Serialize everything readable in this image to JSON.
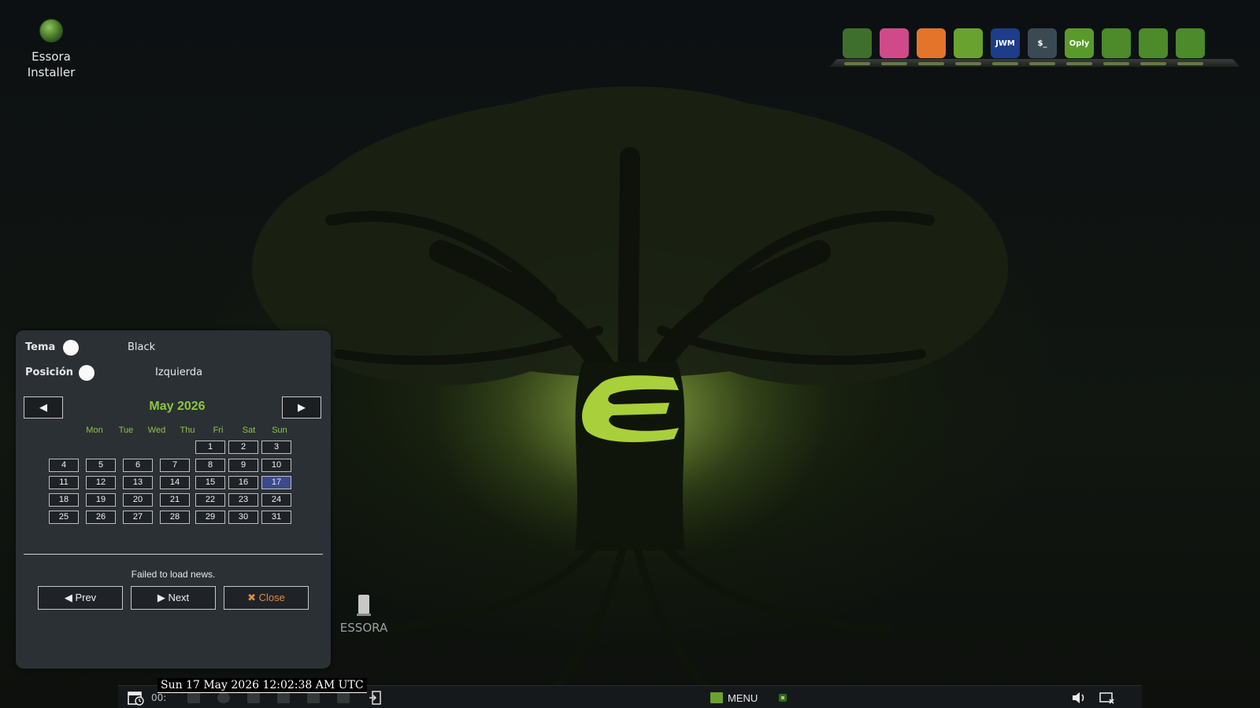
{
  "desktop": {
    "installer_label": "Essora Installer",
    "drive_label": "ESSORA"
  },
  "dock": {
    "items": [
      {
        "icon": "files-icon",
        "label": "",
        "color": "#3f6f2c"
      },
      {
        "icon": "colors-icon",
        "label": "",
        "color": "#d04a8a"
      },
      {
        "icon": "firefox-icon",
        "label": "",
        "color": "#e3742a"
      },
      {
        "icon": "package-icon",
        "label": "",
        "color": "#6aa22f"
      },
      {
        "icon": "jwm-icon",
        "label": "JWM",
        "color": "#1d3d8a"
      },
      {
        "icon": "terminal-icon",
        "label": "$_",
        "color": "#3b4a52"
      },
      {
        "icon": "oply-icon",
        "label": "Oply",
        "color": "#5a9a2a"
      },
      {
        "icon": "oply-radio-icon",
        "label": "",
        "color": "#4c8a2a"
      },
      {
        "icon": "oply-control-icon",
        "label": "",
        "color": "#4c8a2a"
      },
      {
        "icon": "oply-video-icon",
        "label": "",
        "color": "#4c8a2a"
      }
    ]
  },
  "panel": {
    "tema_label": "Tema",
    "tema_value": "Black",
    "posicion_label": "Posición",
    "posicion_value": "Izquierda",
    "prev_month_symbol": "◀",
    "next_month_symbol": "▶",
    "month_title": "May 2026",
    "weekdays": [
      "Mon",
      "Tue",
      "Wed",
      "Thu",
      "Fri",
      "Sat",
      "Sun"
    ],
    "first_weekday_index": 4,
    "days_in_month": 31,
    "today": 17,
    "news_status": "Failed to load news.",
    "prev_label": "◀ Prev",
    "next_label": "▶ Next",
    "close_label": "✖ Close"
  },
  "taskbar": {
    "clock_tooltip": "Sun 17 May 2026 12:02:38 AM UTC",
    "time_short": "00:",
    "menu_label": "MENU"
  },
  "colors": {
    "accent": "#8dc63f",
    "today": "#3b4a8a",
    "close": "#e5883c"
  }
}
